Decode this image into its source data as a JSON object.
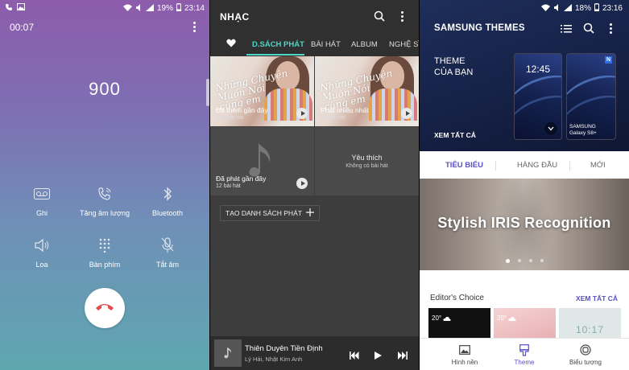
{
  "call": {
    "status_time": "23:14",
    "battery": "19%",
    "timer": "00:07",
    "number": "900",
    "buttons": [
      {
        "label": "Ghi",
        "icon": "voicemail-icon"
      },
      {
        "label": "Tăng âm lượng",
        "icon": "phone-volume-icon"
      },
      {
        "label": "Bluetooth",
        "icon": "bluetooth-icon"
      },
      {
        "label": "Loa",
        "icon": "speaker-icon"
      },
      {
        "label": "Bàn phím",
        "icon": "keypad-icon"
      },
      {
        "label": "Tắt âm",
        "icon": "mic-mute-icon"
      }
    ],
    "end_call_color": "#e24a4a"
  },
  "music": {
    "title": "NHẠC",
    "tabs": [
      "D.SÁCH PHÁT",
      "BÀI HÁT",
      "ALBUM",
      "NGHỆ SĨ"
    ],
    "active_tab": "D.SÁCH PHÁT",
    "accent": "#4fd6c6",
    "tiles": [
      {
        "name": "Đã thêm gần đây",
        "count": "160 bài hát"
      },
      {
        "name": "Phát nhiều nhất",
        "count": "10 bài hát"
      },
      {
        "name": "Đã phát gần đây",
        "count": "12 bài hát"
      },
      {
        "name": "Yêu thích",
        "count": "Không có bài hát"
      }
    ],
    "create_playlist": "TẠO DANH SÁCH PHÁT",
    "now_playing": {
      "song": "Thiên Duyên Tiền Định",
      "artist": "Lý Hải, Nhật Kim Anh"
    }
  },
  "themes": {
    "status_time": "23:16",
    "battery": "18%",
    "title": "SAMSUNG THEMES",
    "my_theme": [
      "THEME",
      "CỦA BẠN"
    ],
    "see_all": "XEM TẤT CẢ",
    "preview_clock": "12:45",
    "phone_brand": "SAMSUNG Galaxy S8+",
    "tabs": [
      "TIÊU BIỂU",
      "HÀNG ĐẦU",
      "MỚI"
    ],
    "active_tab": "TIÊU BIỂU",
    "banner": "Stylish IRIS Recognition",
    "editors_choice": "Editor's Choice",
    "editors_see_all": "XEM TẤT CẢ",
    "card_values": [
      "20°",
      "20°",
      "10:17"
    ],
    "nav": [
      {
        "label": "Hình nền",
        "icon": "wallpaper-icon"
      },
      {
        "label": "Theme",
        "icon": "theme-brush-icon"
      },
      {
        "label": "Biểu tượng",
        "icon": "icons-icon"
      }
    ],
    "accent": "#5a4fc0"
  }
}
